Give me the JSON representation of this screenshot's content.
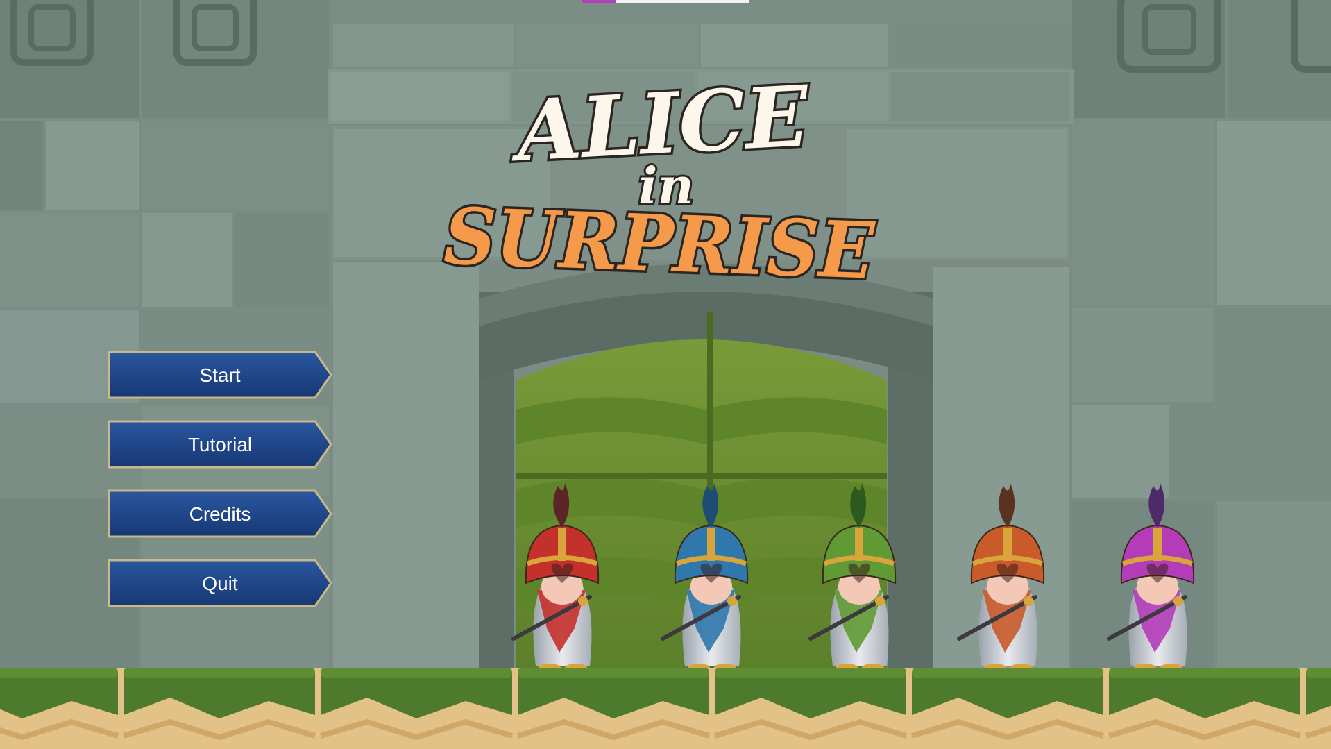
{
  "game": {
    "title_line1": "ALICE",
    "title_line2": "in",
    "title_line3": "SURPRISE",
    "title_colors": {
      "light": "#fdf6ea",
      "accent": "#f59a4a",
      "outline": "#2a2522"
    }
  },
  "menu": {
    "items": [
      {
        "id": "start",
        "label": "Start"
      },
      {
        "id": "tutorial",
        "label": "Tutorial"
      },
      {
        "id": "credits",
        "label": "Credits"
      },
      {
        "id": "quit",
        "label": "Quit"
      }
    ],
    "button_color": "#1f4589",
    "border_color": "#c9b98a"
  },
  "guards": [
    {
      "name": "red-card-guard",
      "color": "#c4302c",
      "plume": "#5c2426"
    },
    {
      "name": "blue-card-guard",
      "color": "#2e78ad",
      "plume": "#1f4d72"
    },
    {
      "name": "green-card-guard",
      "color": "#5f9a34",
      "plume": "#2c5a1e"
    },
    {
      "name": "orange-card-guard",
      "color": "#c95a2a",
      "plume": "#5b3220"
    },
    {
      "name": "purple-card-guard",
      "color": "#b43cb8",
      "plume": "#4e2a6b"
    }
  ],
  "palette": {
    "wall": "#7d9088",
    "wall_dark": "#5f7069",
    "grass": "#4d7a2c",
    "sand": "#e6c48a"
  }
}
